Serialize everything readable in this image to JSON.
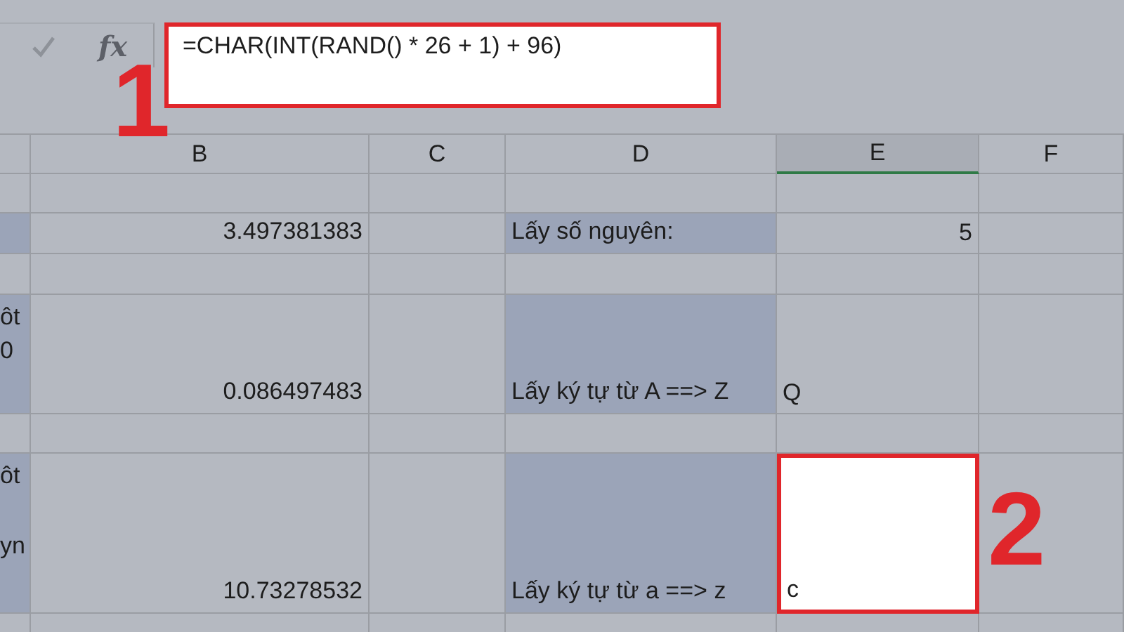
{
  "formula_bar": {
    "function_label": "fx",
    "formula": "=CHAR(INT(RAND() * 26 + 1) + 96)"
  },
  "annotations": [
    {
      "label": "1"
    },
    {
      "label": "2"
    }
  ],
  "columns": [
    {
      "label": "B",
      "selected": false
    },
    {
      "label": "C",
      "selected": false
    },
    {
      "label": "D",
      "selected": false
    },
    {
      "label": "E",
      "selected": true
    },
    {
      "label": "F",
      "selected": false
    }
  ],
  "rows": [
    {
      "kind": "blank"
    },
    {
      "kind": "data",
      "column_a": [],
      "b": "3.497381383",
      "d": "Lấy số nguyên:",
      "e": "5",
      "selected": false
    },
    {
      "kind": "blank"
    },
    {
      "kind": "data",
      "column_a": [
        "ôt",
        "0"
      ],
      "b": "0.086497483",
      "d": "Lấy ký tự từ A ==> Z",
      "e": "Q",
      "selected": false
    },
    {
      "kind": "blank"
    },
    {
      "kind": "data",
      "column_a": [
        "ôt",
        "yn"
      ],
      "b": "10.73278532",
      "d": "Lấy ký tự từ a ==> z",
      "e": "c",
      "selected": true
    },
    {
      "kind": "blank"
    }
  ]
}
